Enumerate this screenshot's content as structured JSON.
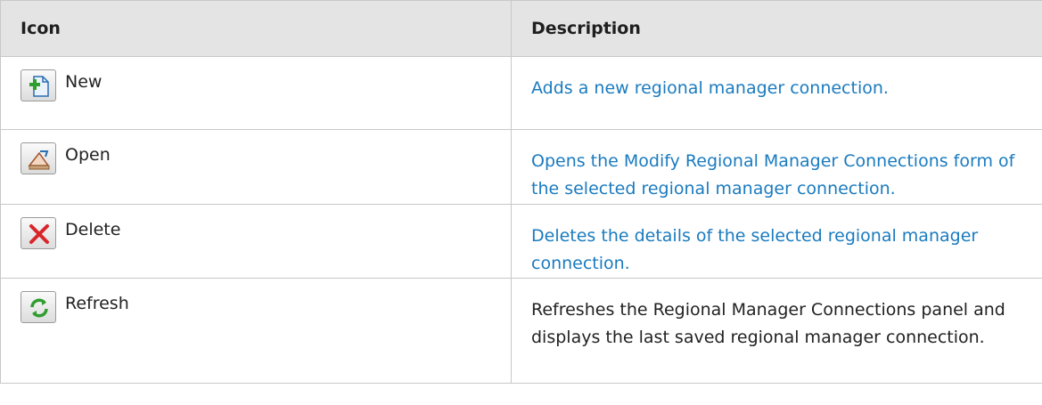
{
  "header": {
    "col_icon": "Icon",
    "col_description": "Description"
  },
  "rows": [
    {
      "icon": "new-icon",
      "label": "New",
      "description": "Adds a new regional manager connection.",
      "desc_color": "#1a7bbf"
    },
    {
      "icon": "open-icon",
      "label": "Open",
      "description": "Opens the Modify Regional Manager Connections form of the selected regional manager connection.",
      "desc_color": "#1a7bbf"
    },
    {
      "icon": "delete-icon",
      "label": "Delete",
      "description": "Deletes the details of the selected regional manager connection.",
      "desc_color": "#1a7bbf"
    },
    {
      "icon": "refresh-icon",
      "label": "Refresh",
      "description": "Refreshes the Regional Manager Connections panel and displays the last saved regional manager connection.",
      "desc_color": "#222222"
    }
  ]
}
